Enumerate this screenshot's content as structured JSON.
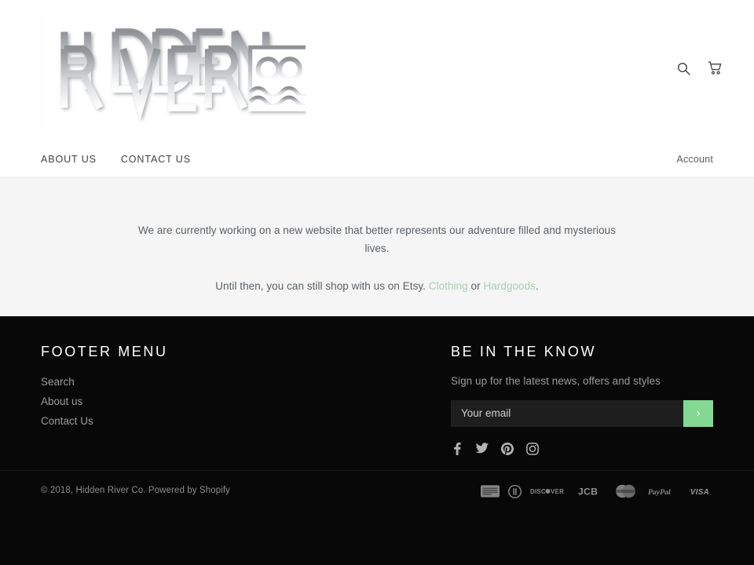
{
  "header": {
    "logo_alt": "Hidden River Co",
    "logo_line1": "HIDDEN",
    "logo_line2": "RIVER",
    "logo_badge": "CO",
    "search_icon": "search-icon",
    "cart_icon": "cart-icon"
  },
  "nav": {
    "items": [
      {
        "label": "ABOUT US"
      },
      {
        "label": "CONTACT US"
      }
    ],
    "account_label": "Account"
  },
  "main": {
    "paragraph1": "We are currently working on a new website that better represents our adventure filled and mysterious lives.",
    "p2_before": "Until then, you can still shop with us on Etsy. ",
    "p2_link1": "Clothing",
    "p2_middle": " or ",
    "p2_link2": "Hardgoods",
    "p2_after": ".",
    "link_color": "#a9ceb2"
  },
  "footer": {
    "menu": {
      "title": "FOOTER MENU",
      "items": [
        {
          "label": "Search"
        },
        {
          "label": "About us"
        },
        {
          "label": "Contact Us"
        }
      ]
    },
    "newsletter": {
      "title": "BE IN THE KNOW",
      "subtitle": "Sign up for the latest news, offers and styles",
      "email_value": "",
      "email_placeholder": "Your email",
      "submit_label": "›",
      "submit_color": "#84d894"
    },
    "socials": [
      {
        "name": "facebook-icon",
        "label": "Facebook"
      },
      {
        "name": "twitter-icon",
        "label": "Twitter"
      },
      {
        "name": "pinterest-icon",
        "label": "Pinterest"
      },
      {
        "name": "instagram-icon",
        "label": "Instagram"
      }
    ],
    "copyright_prefix": "© 2018, Hidden River Co. Powered by ",
    "copyright_link": "Shopify",
    "payments": [
      {
        "name": "american-express",
        "label": "American Express"
      },
      {
        "name": "diners-club",
        "label": "Diners Club"
      },
      {
        "name": "discover",
        "label": "Discover"
      },
      {
        "name": "jcb",
        "label": "JCB"
      },
      {
        "name": "mastercard",
        "label": "Mastercard"
      },
      {
        "name": "paypal",
        "label": "PayPal"
      },
      {
        "name": "visa",
        "label": "VISA"
      }
    ]
  }
}
